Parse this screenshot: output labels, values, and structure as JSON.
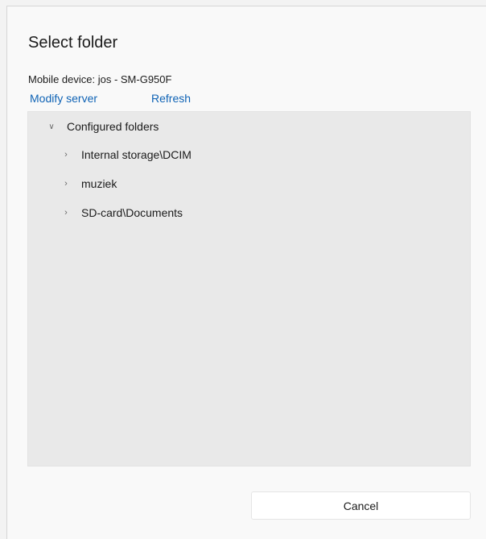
{
  "dialog": {
    "title": "Select folder",
    "device_line": "Mobile device: jos - SM-G950F",
    "modify_server_label": "Modify server",
    "refresh_label": "Refresh",
    "cancel_label": "Cancel"
  },
  "tree": {
    "root_label": "Configured folders",
    "root_icon": "chevron-down-icon",
    "items": [
      {
        "label": "Internal storage\\DCIM",
        "icon": "chevron-right-icon"
      },
      {
        "label": "muziek",
        "icon": "chevron-right-icon"
      },
      {
        "label": "SD-card\\Documents",
        "icon": "chevron-right-icon"
      }
    ]
  },
  "colors": {
    "link": "#0f63b5",
    "tree_background": "#e9e9e9",
    "dialog_background": "#f9f9f9"
  }
}
